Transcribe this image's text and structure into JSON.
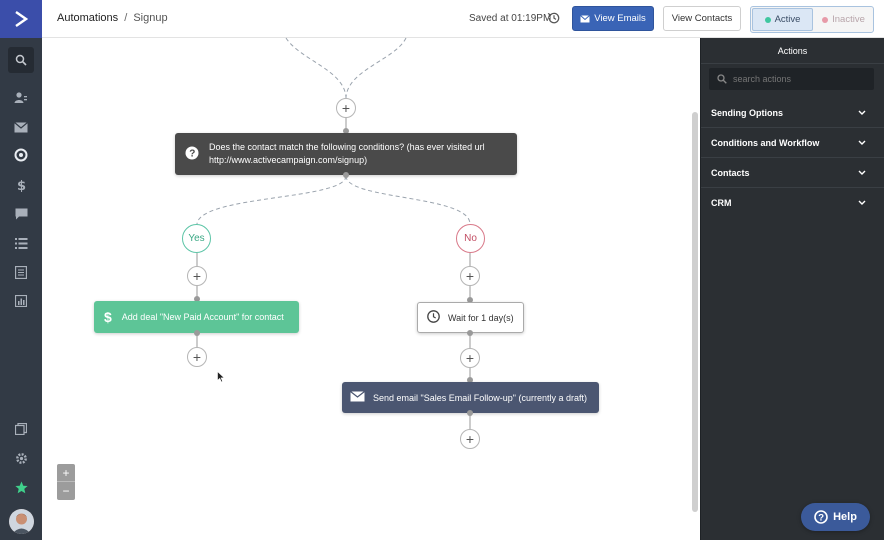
{
  "header": {
    "breadcrumb_root": "Automations",
    "breadcrumb_sep": "/",
    "breadcrumb_current": "Signup",
    "saved_text": "Saved at 01:19PM",
    "view_emails_label": "View Emails",
    "view_contacts_label": "View Contacts",
    "status_active_label": "Active",
    "status_inactive_label": "Inactive",
    "active_color": "#3aa884",
    "inactive_color": "#d97a8a"
  },
  "canvas": {
    "condition_text": "Does the contact match the following conditions? (has ever visited url http://www.activecampaign.com/signup)",
    "yes_label": "Yes",
    "no_label": "No",
    "deal_action": "Add deal \"New Paid Account\" for contact",
    "wait_action": "Wait for 1 day(s)",
    "email_action": "Send email \"Sales Email Follow-up\" (currently a draft)",
    "plus_symbol": "+",
    "zoom_in": "+",
    "zoom_out": "−"
  },
  "panel": {
    "title": "Actions",
    "search_placeholder": "search actions",
    "items": [
      {
        "label": "Sending Options"
      },
      {
        "label": "Conditions and Workflow"
      },
      {
        "label": "Contacts"
      },
      {
        "label": "CRM"
      }
    ]
  },
  "help": {
    "label": "Help"
  },
  "colors": {
    "sidebar": "#323a45",
    "logo": "#3b4eaa",
    "primary_button": "#3a64b6",
    "deal_node": "#5dc597",
    "email_node": "#4b5671",
    "condition_node": "#4a4a4a",
    "panel": "#2b2f33"
  }
}
